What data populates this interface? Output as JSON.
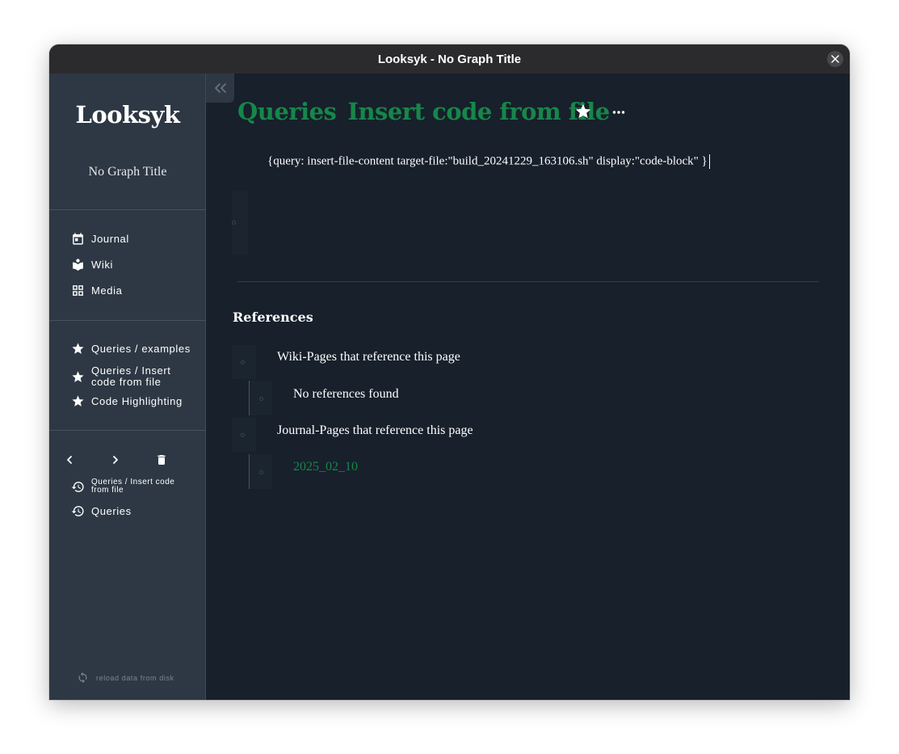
{
  "window": {
    "title": "Looksyk - No Graph Title"
  },
  "sidebar": {
    "brand": "Looksyk",
    "graph_title": "No Graph Title",
    "nav": [
      {
        "label": "Journal",
        "icon": "calendar-icon"
      },
      {
        "label": "Wiki",
        "icon": "book-icon"
      },
      {
        "label": "Media",
        "icon": "grid-icon"
      }
    ],
    "favourites": [
      {
        "label": "Queries / examples",
        "icon": "star-icon"
      },
      {
        "label": "Queries / Insert code from file",
        "icon": "star-icon"
      },
      {
        "label": "Code Highlighting",
        "icon": "star-icon"
      }
    ],
    "history": [
      {
        "label": "Queries / Insert code from file",
        "icon": "history-icon"
      },
      {
        "label": "Queries",
        "icon": "history-icon"
      }
    ],
    "reload_label": "reload data from disk"
  },
  "page": {
    "title_part1": "Queries",
    "title_part2": "Insert code from file",
    "block_text": "{query: insert-file-content target-file:\"build_20241229_163106.sh\" display:\"code-block\" }",
    "references": {
      "title": "References",
      "wiki_label": "Wiki-Pages that reference this page",
      "wiki_empty": "No references found",
      "journal_label": "Journal-Pages that reference this page",
      "journal_items": [
        "2025_02_10"
      ]
    }
  },
  "colors": {
    "accent": "#17864a",
    "sidebar_bg": "#2d3844",
    "main_bg": "#17202b",
    "titlebar_bg": "#2b2b2e"
  }
}
